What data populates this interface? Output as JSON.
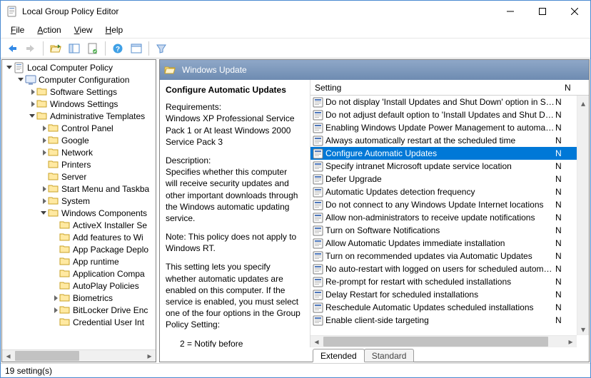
{
  "window": {
    "title": "Local Group Policy Editor"
  },
  "menu": {
    "file": "File",
    "action": "Action",
    "view": "View",
    "help": "Help"
  },
  "tree": {
    "root": "Local Computer Policy",
    "cc": "Computer Configuration",
    "ss": "Software Settings",
    "ws": "Windows Settings",
    "at": "Administrative Templates",
    "cp": "Control Panel",
    "google": "Google",
    "network": "Network",
    "printers": "Printers",
    "server": "Server",
    "smtb": "Start Menu and Taskba",
    "system": "System",
    "wc": "Windows Components",
    "ax": "ActiveX Installer Se",
    "af": "Add features to Wi",
    "apd": "App Package Deplo",
    "ar": "App runtime",
    "ac": "Application Compa",
    "ap": "AutoPlay Policies",
    "bio": "Biometrics",
    "bde": "BitLocker Drive Enc",
    "cui": "Credential User Int"
  },
  "console": {
    "header": "Windows Update"
  },
  "desc": {
    "title": "Configure Automatic Updates",
    "req_label": "Requirements:",
    "req_text": "Windows XP Professional Service Pack 1 or At least Windows 2000 Service Pack 3",
    "desc_label": "Description:",
    "desc_text": "Specifies whether this computer will receive security updates and other important downloads through the Windows automatic updating service.",
    "note": "Note: This policy does not apply to Windows RT.",
    "extra": "This setting lets you specify whether automatic updates are enabled on this computer. If the service is enabled, you must select one of the four options in the Group Policy Setting:",
    "opt2": "2 = Notify before"
  },
  "list": {
    "col_setting": "Setting",
    "col_state_truncated": "N",
    "items": [
      {
        "label": "Do not display 'Install Updates and Shut Down' option in Sh...",
        "state": "N",
        "selected": false
      },
      {
        "label": "Do not adjust default option to 'Install Updates and Shut Do...",
        "state": "N",
        "selected": false
      },
      {
        "label": "Enabling Windows Update Power Management to automati...",
        "state": "N",
        "selected": false
      },
      {
        "label": "Always automatically restart at the scheduled time",
        "state": "N",
        "selected": false
      },
      {
        "label": "Configure Automatic Updates",
        "state": "N",
        "selected": true
      },
      {
        "label": "Specify intranet Microsoft update service location",
        "state": "N",
        "selected": false
      },
      {
        "label": "Defer Upgrade",
        "state": "N",
        "selected": false
      },
      {
        "label": "Automatic Updates detection frequency",
        "state": "N",
        "selected": false
      },
      {
        "label": "Do not connect to any Windows Update Internet locations",
        "state": "N",
        "selected": false
      },
      {
        "label": "Allow non-administrators to receive update notifications",
        "state": "N",
        "selected": false
      },
      {
        "label": "Turn on Software Notifications",
        "state": "N",
        "selected": false
      },
      {
        "label": "Allow Automatic Updates immediate installation",
        "state": "N",
        "selected": false
      },
      {
        "label": "Turn on recommended updates via Automatic Updates",
        "state": "N",
        "selected": false
      },
      {
        "label": "No auto-restart with logged on users for scheduled automat...",
        "state": "N",
        "selected": false
      },
      {
        "label": "Re-prompt for restart with scheduled installations",
        "state": "N",
        "selected": false
      },
      {
        "label": "Delay Restart for scheduled installations",
        "state": "N",
        "selected": false
      },
      {
        "label": "Reschedule Automatic Updates scheduled installations",
        "state": "N",
        "selected": false
      },
      {
        "label": "Enable client-side targeting",
        "state": "N",
        "selected": false
      }
    ]
  },
  "tabs": {
    "extended": "Extended",
    "standard": "Standard"
  },
  "status": {
    "text": "19 setting(s)"
  }
}
